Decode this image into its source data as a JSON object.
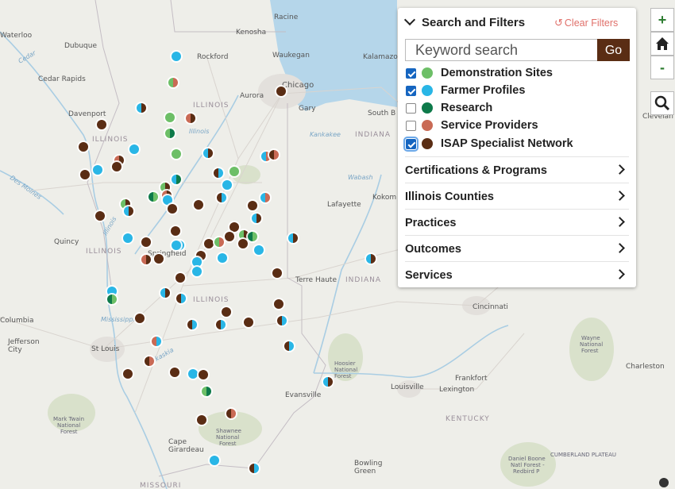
{
  "panel": {
    "title": "Search and Filters",
    "clear_label": "Clear Filters",
    "search": {
      "placeholder": "Keyword search",
      "value": "",
      "go_label": "Go"
    },
    "layers": [
      {
        "label": "Demonstration Sites",
        "checked": true,
        "color": "#6dbf67"
      },
      {
        "label": "Farmer Profiles",
        "checked": true,
        "color": "#29b6e6"
      },
      {
        "label": "Research",
        "checked": false,
        "color": "#0e7a4a"
      },
      {
        "label": "Service Providers",
        "checked": false,
        "color": "#c96a55"
      },
      {
        "label": "ISAP Specialist Network",
        "checked": true,
        "color": "#5a2d14"
      }
    ],
    "sections": [
      {
        "label": "Certifications & Programs"
      },
      {
        "label": "Illinois Counties"
      },
      {
        "label": "Practices"
      },
      {
        "label": "Outcomes"
      },
      {
        "label": "Services"
      }
    ]
  },
  "map": {
    "controls": {
      "zoom_in": "+",
      "zoom_out": "-",
      "home_icon": "home-icon",
      "search_icon": "search-icon"
    },
    "cities": [
      "Racine",
      "Kenosha",
      "Waukegan",
      "Kalamazoo",
      "Waterloo",
      "Dubuque",
      "Rockford",
      "Chicago",
      "Aurora",
      "Gary",
      "South Bend",
      "Cedar Rapids",
      "Davenport",
      "Lafayette",
      "Kokomo",
      "Quincy",
      "Springfield",
      "Terre Haute",
      "Indiana",
      "Columbia",
      "Jefferson City",
      "St Louis",
      "Cincinnati",
      "Frankfort",
      "Lexington",
      "Louisville",
      "Evansville",
      "Cape Girardeau",
      "Bowling Green",
      "Charleston",
      "Cleveland"
    ],
    "state_labels": [
      "ILLINOIS",
      "ILLINOIS",
      "ILLINOIS",
      "ILLINOIS",
      "INDIANA",
      "INDIANA",
      "KENTUCKY",
      "MISSOURI"
    ],
    "water_labels": [
      "Illinois",
      "Kankakee",
      "Wabash",
      "Des Moines",
      "Illinois",
      "Mississippi",
      "Kaskaskia",
      "Cedar"
    ],
    "park_labels": [
      "Hoosier National Forest",
      "Mark Twain National Forest",
      "Shawnee National Forest",
      "Wayne National Forest",
      "Daniel Boone Natl Forest - Redbird P",
      "CUMBERLAND PLATEAU"
    ]
  }
}
